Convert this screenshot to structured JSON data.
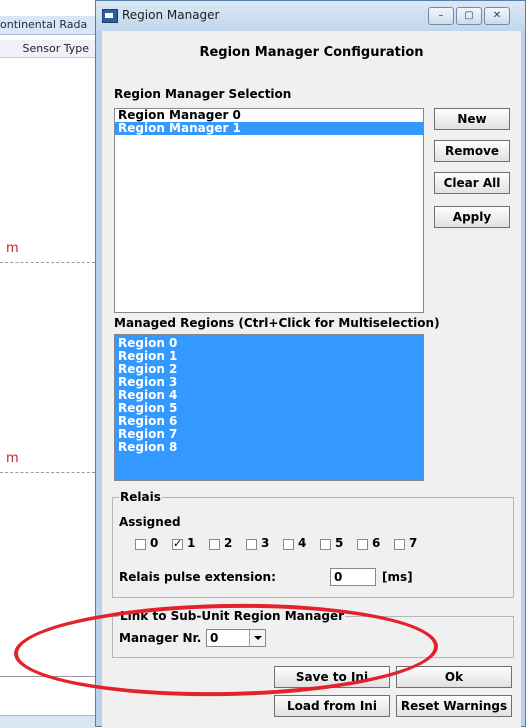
{
  "background": {
    "tab_title": "ontinental Rada",
    "column_header": "Sensor Type",
    "marker_top": "m",
    "marker_bottom": "m"
  },
  "window": {
    "title": "Region Manager",
    "controls": {
      "minimize": "–",
      "maximize": "▢",
      "close": "✕"
    }
  },
  "dialog": {
    "heading": "Region Manager Configuration",
    "selection_label": "Region Manager Selection",
    "managers": [
      {
        "label": "Region Manager 0",
        "selected": false
      },
      {
        "label": "Region Manager 1",
        "selected": true
      }
    ],
    "buttons": {
      "new": "New",
      "remove": "Remove",
      "clear_all": "Clear All",
      "apply": "Apply",
      "save_to_ini": "Save to Ini",
      "ok": "Ok",
      "load_from_ini": "Load from Ini",
      "reset_warnings": "Reset Warnings"
    },
    "managed_regions_label": "Managed Regions (Ctrl+Click for Multiselection)",
    "regions": [
      "Region 0",
      "Region 1",
      "Region 2",
      "Region 3",
      "Region 4",
      "Region 5",
      "Region 6",
      "Region 7",
      "Region 8"
    ],
    "relais": {
      "group_label": "Relais",
      "assigned_label": "Assigned",
      "checkboxes": [
        {
          "label": "0",
          "checked": false
        },
        {
          "label": "1",
          "checked": true
        },
        {
          "label": "2",
          "checked": false
        },
        {
          "label": "3",
          "checked": false
        },
        {
          "label": "4",
          "checked": false
        },
        {
          "label": "5",
          "checked": false
        },
        {
          "label": "6",
          "checked": false
        },
        {
          "label": "7",
          "checked": false
        }
      ],
      "pulse_label": "Relais pulse extension:",
      "pulse_value": "0",
      "pulse_unit": "[ms]"
    },
    "link": {
      "group_label": "Link to Sub-Unit Region Manager",
      "manager_label": "Manager Nr.",
      "manager_value": "0"
    }
  },
  "annotation_color": "#e3222b",
  "selection_color": "#3399ff"
}
